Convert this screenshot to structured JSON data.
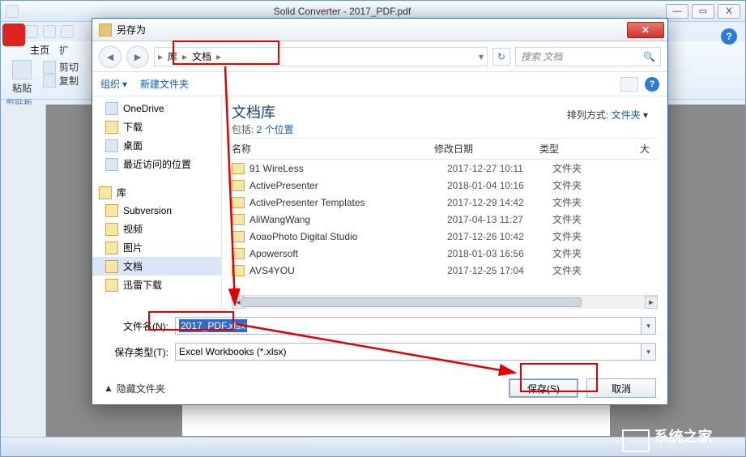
{
  "app": {
    "title": "Solid Converter - 2017_PDF.pdf",
    "tabs": {
      "home": "主页",
      "more": "扩"
    },
    "clip": {
      "paste": "粘贴",
      "cut": "剪切",
      "copy": "复制",
      "group": "剪贴板"
    },
    "win_min": "—",
    "win_max": "▭",
    "win_close": "X"
  },
  "dialog": {
    "title": "另存为",
    "nav_back": "◄",
    "nav_fwd": "►",
    "breadcrumb": {
      "sep0": "▸",
      "c1": "库",
      "sep1": "▸",
      "c2": "文档",
      "sep2": "▸",
      "dd": "▾",
      "refresh": "↻"
    },
    "search_placeholder": "搜索 文档",
    "toolbar": {
      "organize": "组织",
      "organize_dd": "▾",
      "newfolder": "新建文件夹",
      "help": "?"
    },
    "tree": [
      {
        "label": "OneDrive",
        "type": "drive"
      },
      {
        "label": "下载",
        "type": "folder"
      },
      {
        "label": "桌面",
        "type": "drive"
      },
      {
        "label": "最近访问的位置",
        "type": "drive"
      }
    ],
    "tree2_header": "库",
    "tree2": [
      {
        "label": "Subversion",
        "type": "folder"
      },
      {
        "label": "视频",
        "type": "folder"
      },
      {
        "label": "图片",
        "type": "folder"
      },
      {
        "label": "文档",
        "type": "folder",
        "active": true
      },
      {
        "label": "迅雷下载",
        "type": "folder"
      }
    ],
    "lib": {
      "title": "文档库",
      "sub_prefix": "包括: ",
      "sub_link": "2 个位置",
      "sort_label": "排列方式:",
      "sort_value": "文件夹",
      "sort_dd": "▾"
    },
    "cols": {
      "name": "名称",
      "date": "修改日期",
      "type": "类型",
      "size": "大"
    },
    "files": [
      {
        "name": "91 WireLess",
        "date": "2017-12-27 10:11",
        "type": "文件夹"
      },
      {
        "name": "ActivePresenter",
        "date": "2018-01-04 10:16",
        "type": "文件夹"
      },
      {
        "name": "ActivePresenter Templates",
        "date": "2017-12-29 14:42",
        "type": "文件夹"
      },
      {
        "name": "AliWangWang",
        "date": "2017-04-13 11:27",
        "type": "文件夹"
      },
      {
        "name": "AoaoPhoto Digital Studio",
        "date": "2017-12-26 10:42",
        "type": "文件夹"
      },
      {
        "name": "Apowersoft",
        "date": "2018-01-03 16:56",
        "type": "文件夹"
      },
      {
        "name": "AVS4YOU",
        "date": "2017-12-25 17:04",
        "type": "文件夹"
      }
    ],
    "field_filename_label": "文件名(N):",
    "field_filename_value": "2017_PDF.xlsx",
    "field_type_label": "保存类型(T):",
    "field_type_value": "Excel Workbooks (*.xlsx)",
    "hide_folders": "隐藏文件夹",
    "hide_arrow": "▲",
    "btn_save": "保存(S)",
    "btn_cancel": "取消"
  },
  "watermark": {
    "brand": "系统之家",
    "url": "XITONGZHIJIA.NET"
  }
}
